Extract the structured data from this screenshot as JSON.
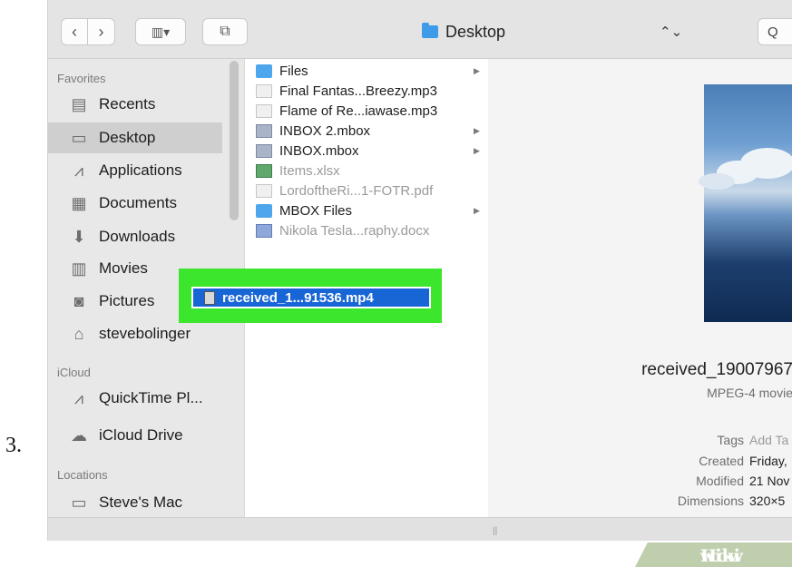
{
  "step_number": "3.",
  "toolbar": {
    "back_glyph": "‹",
    "forward_glyph": "›",
    "view_glyph": "▥▾",
    "newfolder_glyph": "⧉",
    "location": "Desktop",
    "updown_glyph": "⌃",
    "search_glyph": "Q"
  },
  "sidebar": {
    "favorites_label": "Favorites",
    "favorites": [
      {
        "label": "Recents",
        "icon": "clock-icon"
      },
      {
        "label": "Desktop",
        "icon": "desktop-icon"
      },
      {
        "label": "Applications",
        "icon": "applications-icon"
      },
      {
        "label": "Documents",
        "icon": "documents-icon"
      },
      {
        "label": "Downloads",
        "icon": "downloads-icon"
      },
      {
        "label": "Movies",
        "icon": "movies-icon"
      },
      {
        "label": "Pictures",
        "icon": "pictures-icon"
      },
      {
        "label": "stevebolinger",
        "icon": "home-icon"
      }
    ],
    "icloud_label": "iCloud",
    "icloud": [
      {
        "label": "QuickTime Pl...",
        "icon": "quicktime-icon"
      },
      {
        "label": "iCloud Drive",
        "icon": "cloud-icon"
      }
    ],
    "locations_label": "Locations",
    "locations": [
      {
        "label": "Steve's Mac",
        "icon": "computer-icon"
      }
    ]
  },
  "files": [
    {
      "name": "Files",
      "kind": "folder",
      "arrow": "▶"
    },
    {
      "name": "Final Fantas...Breezy.mp3",
      "kind": "doc"
    },
    {
      "name": "Flame of Re...iawase.mp3",
      "kind": "doc"
    },
    {
      "name": "INBOX 2.mbox",
      "kind": "mbox",
      "arrow": "▶"
    },
    {
      "name": "INBOX.mbox",
      "kind": "mbox",
      "arrow": "▶"
    },
    {
      "name": "Items.xlsx",
      "kind": "xls",
      "dim": true
    },
    {
      "name": "LordoftheRi...1-FOTR.pdf",
      "kind": "doc",
      "dim": true
    },
    {
      "name": "MBOX Files",
      "kind": "folder",
      "arrow": "▶"
    },
    {
      "name": "Nikola Tesla...raphy.docx",
      "kind": "word",
      "dim": true
    }
  ],
  "selected_file": "received_1...91536.mp4",
  "preview": {
    "title": "received_19007967",
    "kind": "MPEG-4 movie",
    "tags_label": "Tags",
    "tags_value": "Add Ta",
    "created_label": "Created",
    "created_value": "Friday,",
    "modified_label": "Modified",
    "modified_value": "21 Nov",
    "dimensions_label": "Dimensions",
    "dimensions_value": "320×5"
  },
  "column_handle": "||",
  "watermark": {
    "part1": "wiki",
    "part2": "How"
  }
}
